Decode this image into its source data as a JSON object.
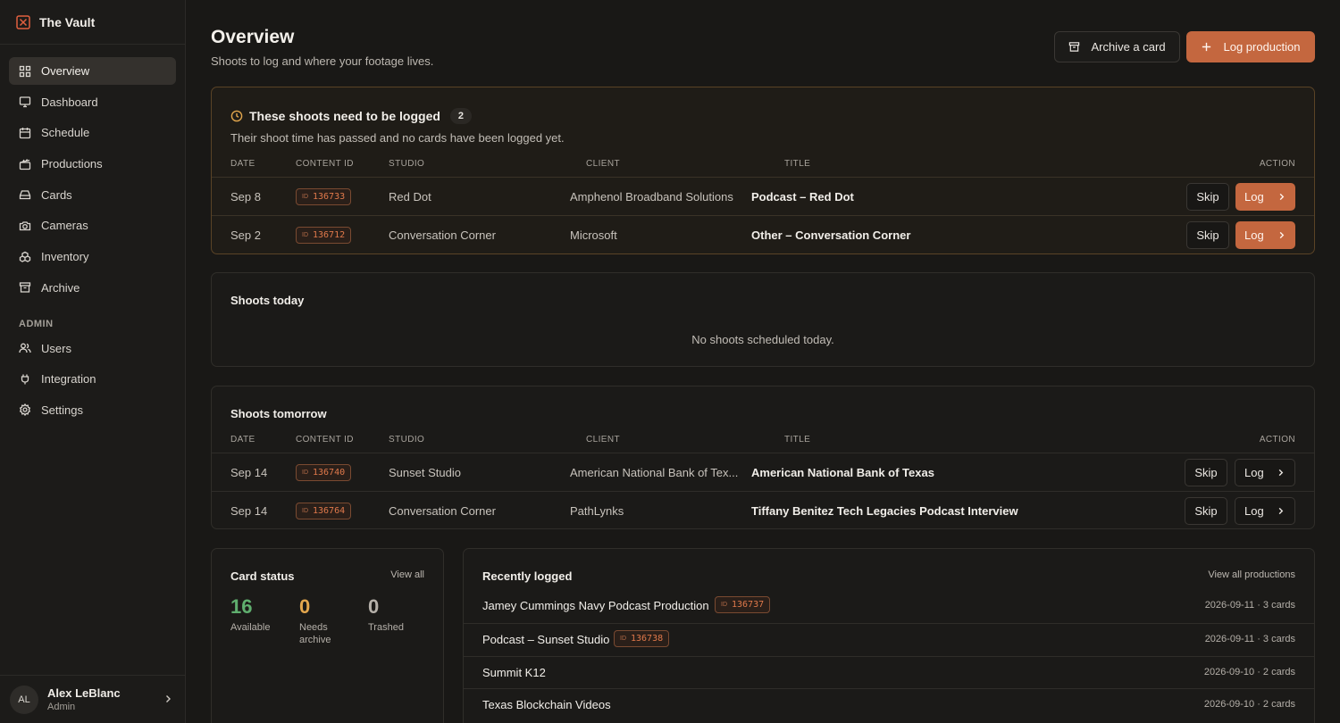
{
  "app": {
    "name": "The Vault"
  },
  "sidebar": {
    "items": [
      {
        "label": "Overview",
        "icon": "grid-icon"
      },
      {
        "label": "Dashboard",
        "icon": "monitor-icon"
      },
      {
        "label": "Schedule",
        "icon": "calendar-icon"
      },
      {
        "label": "Productions",
        "icon": "clapper-icon"
      },
      {
        "label": "Cards",
        "icon": "drive-icon"
      },
      {
        "label": "Cameras",
        "icon": "camera-icon"
      },
      {
        "label": "Inventory",
        "icon": "boxes-icon"
      },
      {
        "label": "Archive",
        "icon": "archive-icon"
      }
    ],
    "admin_label": "ADMIN",
    "admin_items": [
      {
        "label": "Users",
        "icon": "users-icon"
      },
      {
        "label": "Integration",
        "icon": "plug-icon"
      },
      {
        "label": "Settings",
        "icon": "gear-icon"
      }
    ],
    "user": {
      "initials": "AL",
      "name": "Alex LeBlanc",
      "role": "Admin"
    }
  },
  "header": {
    "title": "Overview",
    "subtitle": "Shoots to log and where your footage lives.",
    "archive_label": "Archive a card",
    "log_production_label": "Log production"
  },
  "columns": {
    "date": "DATE",
    "content_id": "CONTENT ID",
    "studio": "STUDIO",
    "client": "CLIENT",
    "title": "TITLE",
    "action": "ACTION"
  },
  "overdue": {
    "title": "These shoots need to be logged",
    "count": "2",
    "description": "Their shoot time has passed and no cards have been logged yet.",
    "rows": [
      {
        "date": "Sep 8",
        "id": "136733",
        "studio": "Red Dot",
        "client": "Amphenol Broadband Solutions",
        "title": "Podcast – Red Dot"
      },
      {
        "date": "Sep 2",
        "id": "136712",
        "studio": "Conversation Corner",
        "client": "Microsoft",
        "title": "Other – Conversation Corner"
      }
    ]
  },
  "today": {
    "title": "Shoots today",
    "empty": "No shoots scheduled today."
  },
  "tomorrow": {
    "title": "Shoots tomorrow",
    "rows": [
      {
        "date": "Sep 14",
        "id": "136740",
        "studio": "Sunset Studio",
        "client": "American National Bank of Tex...",
        "title": "American National Bank of Texas"
      },
      {
        "date": "Sep 14",
        "id": "136764",
        "studio": "Conversation Corner",
        "client": "PathLynks",
        "title": "Tiffany Benitez Tech Legacies Podcast Interview"
      }
    ]
  },
  "actions": {
    "skip": "Skip",
    "log": "Log",
    "id_prefix": "ID"
  },
  "card_status": {
    "title": "Card status",
    "view_all": "View all",
    "stats": [
      {
        "value": "16",
        "label": "Available",
        "color": "#5fae6e"
      },
      {
        "value": "0",
        "label": "Needs archive",
        "color": "#e2a64d"
      },
      {
        "value": "0",
        "label": "Trashed",
        "color": "#b5b0a9"
      }
    ]
  },
  "recent": {
    "title": "Recently logged",
    "view_all": "View all productions",
    "rows": [
      {
        "name": "Jamey Cummings Navy Podcast Production",
        "id": "136737",
        "meta": "2026-09-11 · 3 cards"
      },
      {
        "name": "Podcast – Sunset Studio",
        "id": "136738",
        "meta": "2026-09-11 · 3 cards"
      },
      {
        "name": "Summit K12",
        "id": "",
        "meta": "2026-09-10 · 2 cards"
      },
      {
        "name": "Texas Blockchain Videos",
        "id": "",
        "meta": "2026-09-10 · 2 cards"
      }
    ]
  },
  "colors": {
    "accent": "#c4673f",
    "warning": "#e2a64d",
    "success": "#5fae6e"
  }
}
